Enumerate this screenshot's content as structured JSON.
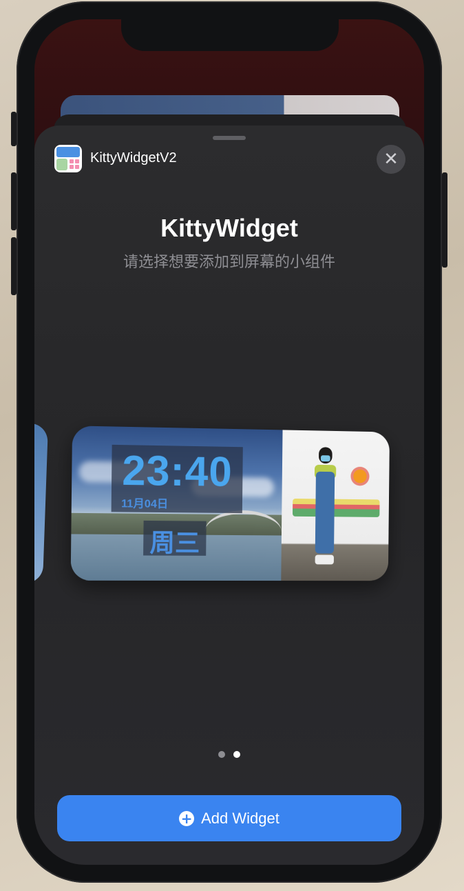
{
  "app": {
    "name": "KittyWidgetV2"
  },
  "sheet": {
    "title": "KittyWidget",
    "subtitle": "请选择想要添加到屏幕的小组件",
    "close_icon": "close-icon"
  },
  "widget": {
    "time": "23:40",
    "date": "11月04日",
    "weekday": "周三"
  },
  "pager": {
    "page_count": 2,
    "current_page": 2
  },
  "add_button": {
    "label": "Add Widget",
    "icon": "plus-circle-icon"
  },
  "colors": {
    "accent": "#3a84f0",
    "time_text": "#4aa6ee",
    "sheet_bg": "#2c2c2e",
    "subtitle": "#8e8e93"
  }
}
